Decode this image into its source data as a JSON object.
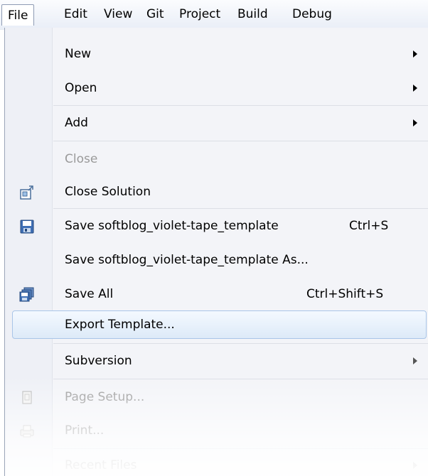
{
  "menubar": {
    "items": [
      "File",
      "Edit",
      "View",
      "Git",
      "Project",
      "Build",
      "Debug"
    ]
  },
  "file_menu": {
    "items": [
      {
        "label": "New",
        "submenu": true
      },
      {
        "label": "Open",
        "submenu": true
      },
      {
        "label": "Add",
        "submenu": true
      },
      {
        "label": "Close",
        "disabled": true
      },
      {
        "label": "Close Solution",
        "icon": "close-solution-icon"
      },
      {
        "label": "Save softblog_violet-tape_template",
        "shortcut": "Ctrl+S",
        "icon": "save-icon"
      },
      {
        "label": "Save softblog_violet-tape_template As..."
      },
      {
        "label": "Save All",
        "shortcut": "Ctrl+Shift+S",
        "icon": "save-all-icon"
      },
      {
        "label": "Export Template...",
        "highlighted": true
      },
      {
        "label": "Subversion",
        "submenu": true
      },
      {
        "label": "Page Setup...",
        "disabled": true,
        "icon": "page-setup-icon"
      },
      {
        "label": "Print...",
        "disabled": true,
        "icon": "print-icon"
      },
      {
        "label": "Recent Files",
        "disabled": true,
        "submenu": true
      }
    ]
  },
  "colors": {
    "highlight_border": "#a9c5e8",
    "disabled_text": "#9a9a9a"
  }
}
